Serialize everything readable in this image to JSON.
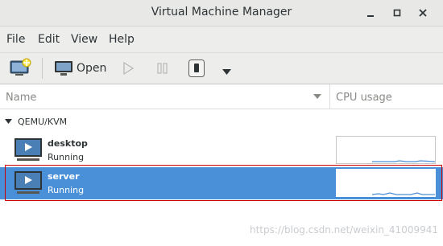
{
  "window": {
    "title": "Virtual Machine Manager"
  },
  "menubar": {
    "items": [
      "File",
      "Edit",
      "View",
      "Help"
    ]
  },
  "toolbar": {
    "open_label": "Open"
  },
  "columns": {
    "name": "Name",
    "cpu": "CPU usage"
  },
  "group": {
    "label": "QEMU/KVM"
  },
  "vms": [
    {
      "name": "desktop",
      "status": "Running",
      "selected": false
    },
    {
      "name": "server",
      "status": "Running",
      "selected": true
    }
  ],
  "colors": {
    "selection": "#4a90d9",
    "graph_line": "#4a90d9",
    "annotation": "#cc0000"
  },
  "watermark": "https://blog.csdn.net/weixin_41009941"
}
